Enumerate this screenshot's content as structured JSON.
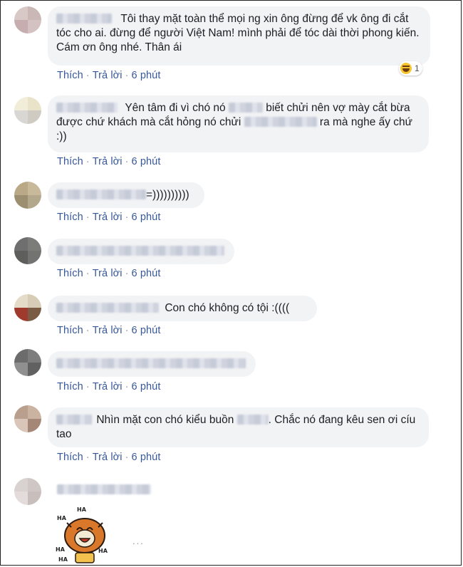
{
  "actions": {
    "like": "Thích",
    "reply": "Trả lời",
    "separator": "·"
  },
  "comments": [
    {
      "author": "",
      "text": "Tôi thay mặt toàn thể mọi ng xin ông đừng để vk ông đi cắt tóc cho ai. đừng để người Việt Nam! mình phải để tóc dài thời phong kiến. Cám ơn ông nhé. Thân ái",
      "time": "6 phút",
      "reaction": {
        "icon": "haha-emoji-icon",
        "count": "1"
      }
    },
    {
      "author": "",
      "text_part1": "Yên tâm đi vì chó nó ",
      "text_part2": " biết chửi nên vợ mày cắt bừa được chứ khách mà cắt hỏng nó chửi ",
      "text_part3": "ra mà nghe ấy chứ :))",
      "time": "6 phút"
    },
    {
      "author": "",
      "text": "=))))))))))",
      "time": "6 phút"
    },
    {
      "author": "",
      "text": "",
      "time": "6 phút"
    },
    {
      "author": "",
      "text": "Con chó không có tội :((((",
      "time": "6 phút"
    },
    {
      "author": "",
      "text": "",
      "time": "6 phút"
    },
    {
      "author": "",
      "text_part1": "Nhìn mặt con chó kiểu buồn ",
      "text_part2": ". Chắc nó đang kêu sen ơi cíu tao",
      "time": "6 phút"
    },
    {
      "author": "",
      "sticker": "laughing-ha-ha-sticker",
      "sticker_text": [
        "HA",
        "HA",
        "HA",
        "HA",
        "HA"
      ],
      "more": "..."
    }
  ],
  "colors": {
    "link": "#365899",
    "bubble": "#f2f3f5",
    "text": "#1c1e21",
    "meta": "#4b4f56"
  }
}
